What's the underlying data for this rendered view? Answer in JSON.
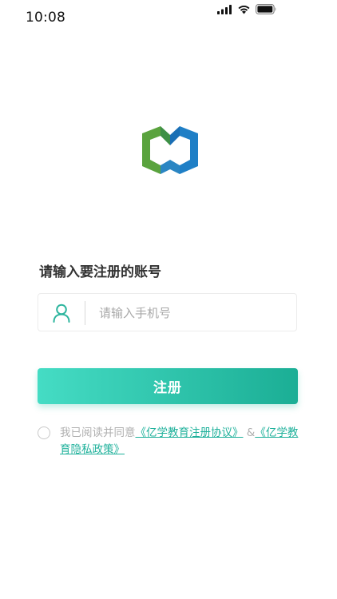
{
  "status_bar": {
    "time": "10:08",
    "icons": [
      "signal-icon",
      "wifi-icon",
      "battery-icon"
    ]
  },
  "logo": {
    "icon": "brand-logo-icon",
    "colors": {
      "green": "#5aa33e",
      "blue": "#1f7fc6"
    }
  },
  "form": {
    "heading": "请输入要注册的账号",
    "phone": {
      "icon": "user-icon",
      "placeholder": "请输入手机号",
      "value": ""
    },
    "register_label": "注册"
  },
  "agreement": {
    "checked": false,
    "prefix": "我已阅读并同意",
    "link1": "《亿学教育注册协议》",
    "joiner": "&",
    "link2": "《亿学教育隐私政策》"
  },
  "colors": {
    "accent_start": "#45dcc4",
    "accent_end": "#1bae95",
    "link": "#1fb19b",
    "muted_text": "#b0b0b0"
  }
}
